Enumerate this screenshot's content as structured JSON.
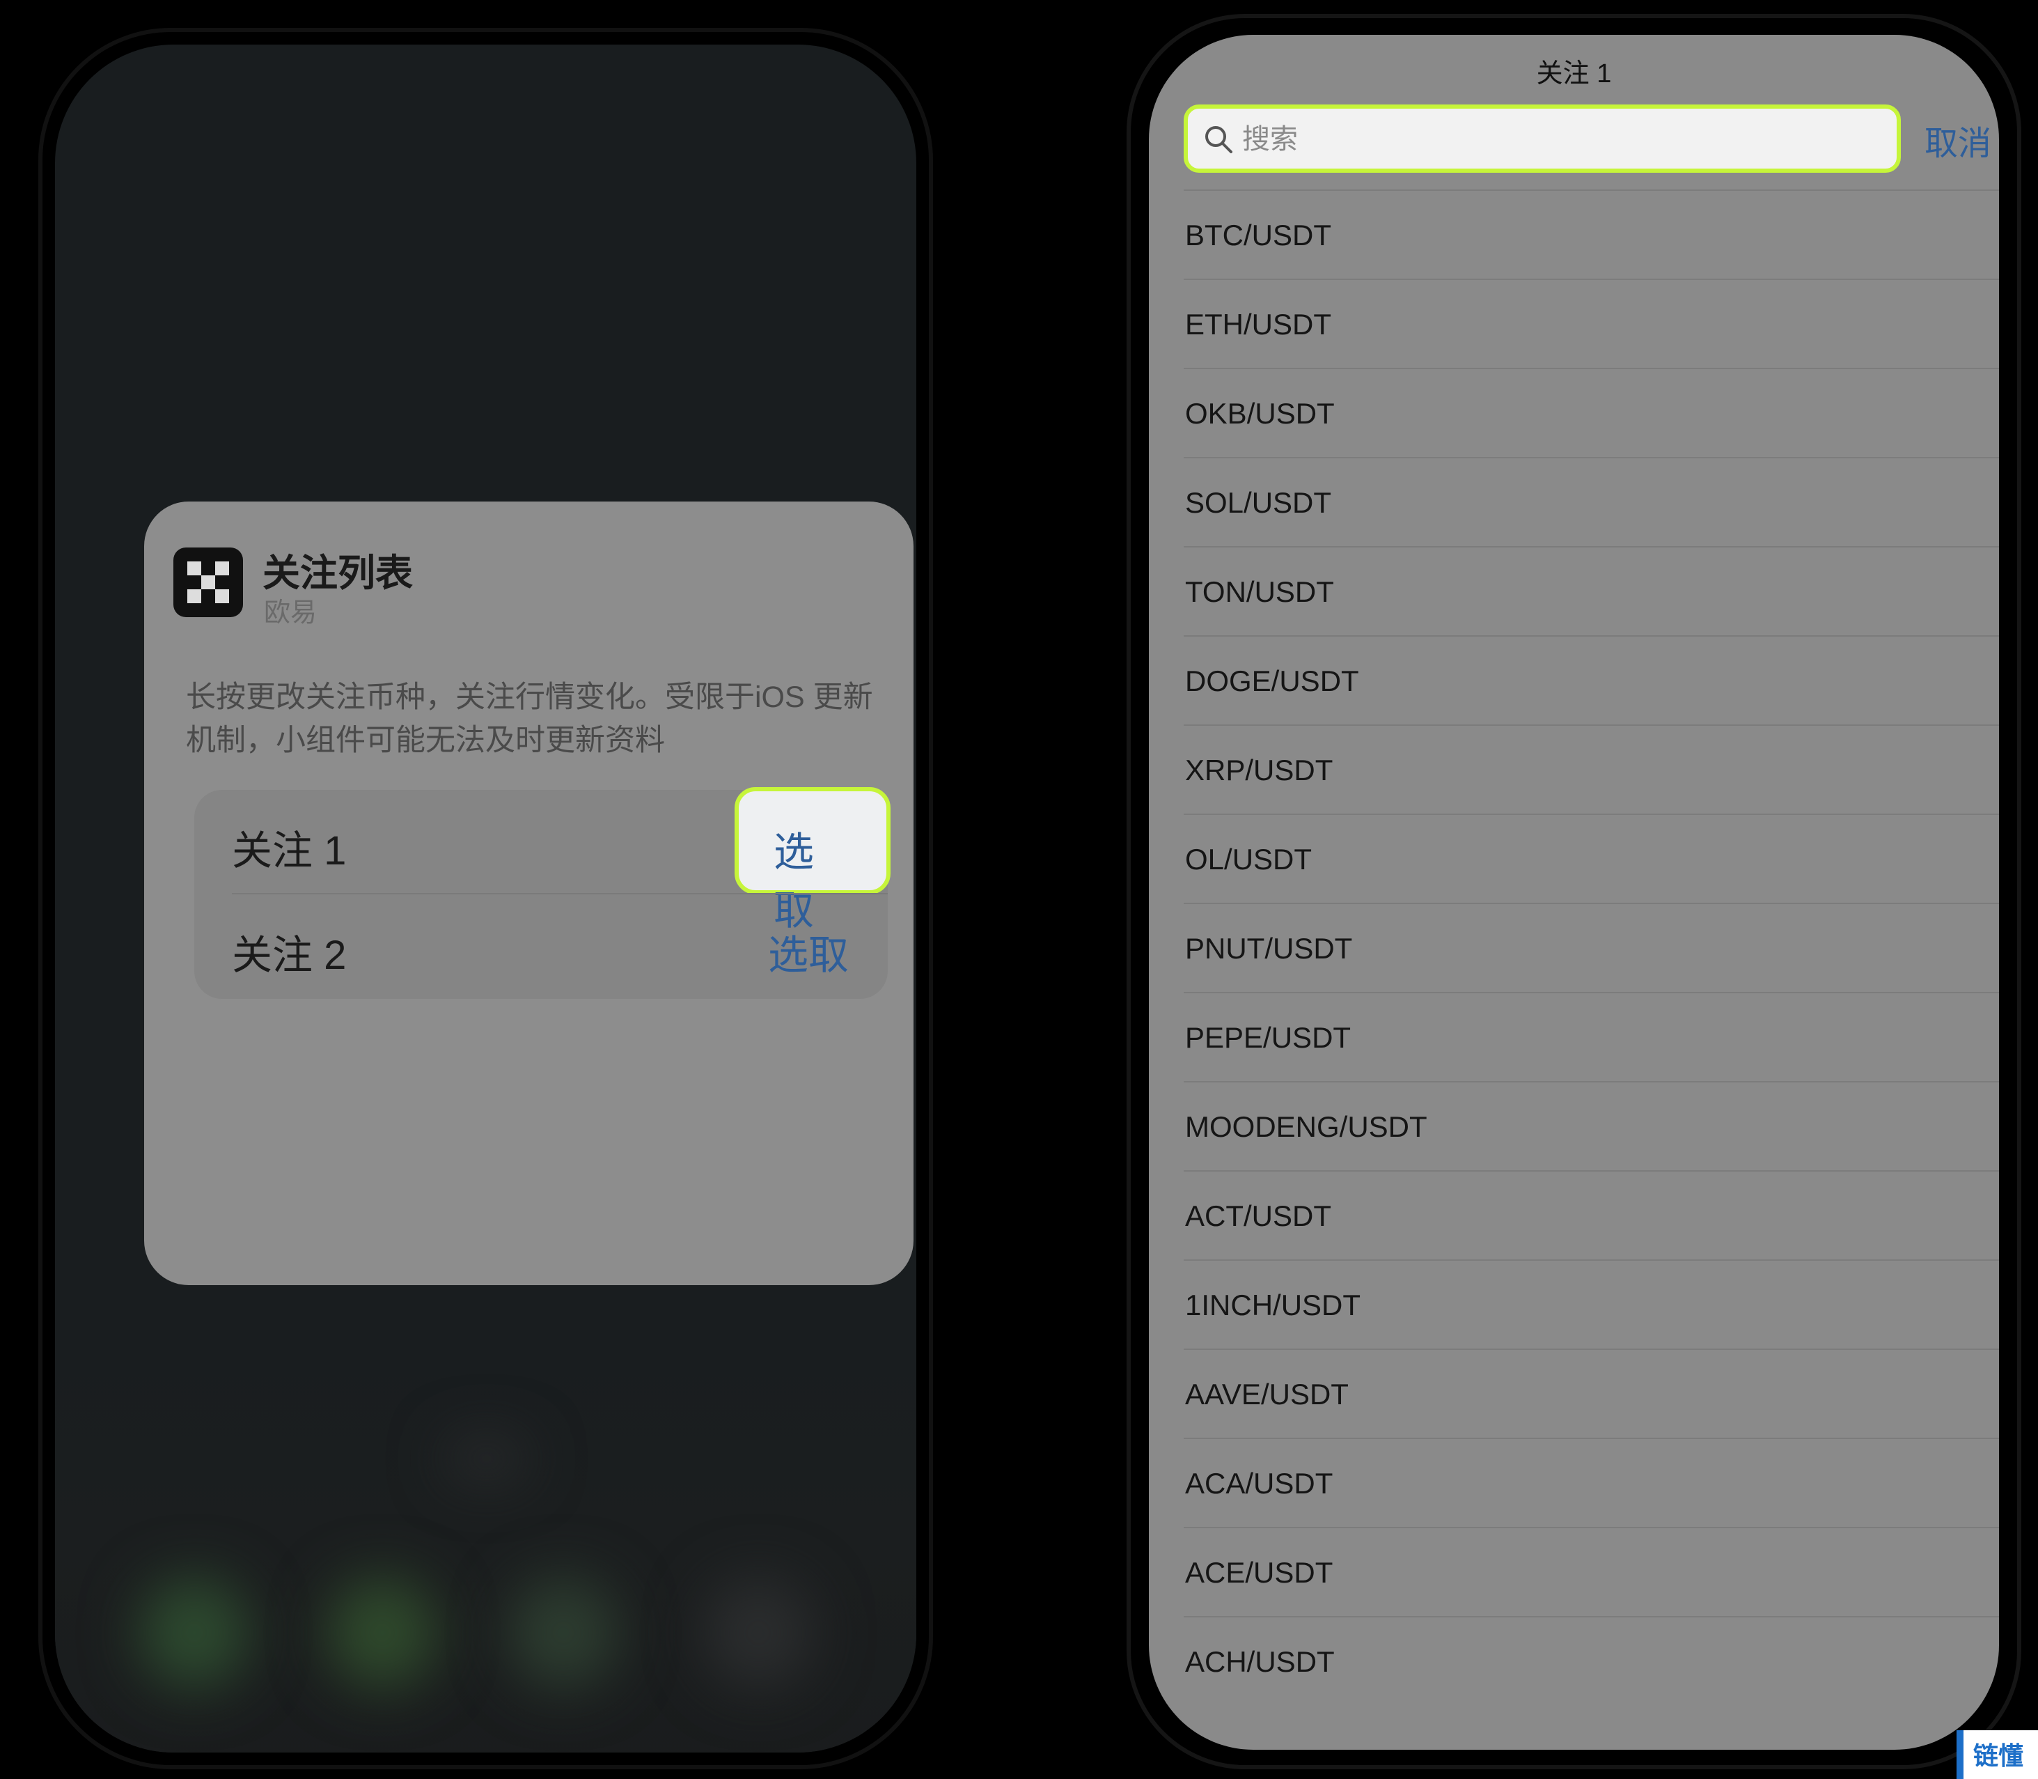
{
  "widget": {
    "title": "关注列表",
    "subtitle": "欧易",
    "description": "长按更改关注币种，关注行情变化。受限于iOS 更新机制，小组件可能无法及时更新资料",
    "options": [
      {
        "label": "关注 1",
        "action": "选取"
      },
      {
        "label": "关注 2",
        "action": "选取"
      }
    ]
  },
  "picker": {
    "title": "关注 1",
    "search_placeholder": "搜索",
    "cancel_label": "取消",
    "pairs": [
      "BTC/USDT",
      "ETH/USDT",
      "OKB/USDT",
      "SOL/USDT",
      "TON/USDT",
      "DOGE/USDT",
      "XRP/USDT",
      "OL/USDT",
      "PNUT/USDT",
      "PEPE/USDT",
      "MOODENG/USDT",
      "ACT/USDT",
      "1INCH/USDT",
      "AAVE/USDT",
      "ACA/USDT",
      "ACE/USDT",
      "ACH/USDT"
    ]
  },
  "watermark": {
    "text": "链懂"
  },
  "colors": {
    "highlight": "#c6f53a",
    "link": "#2e5e9a"
  }
}
